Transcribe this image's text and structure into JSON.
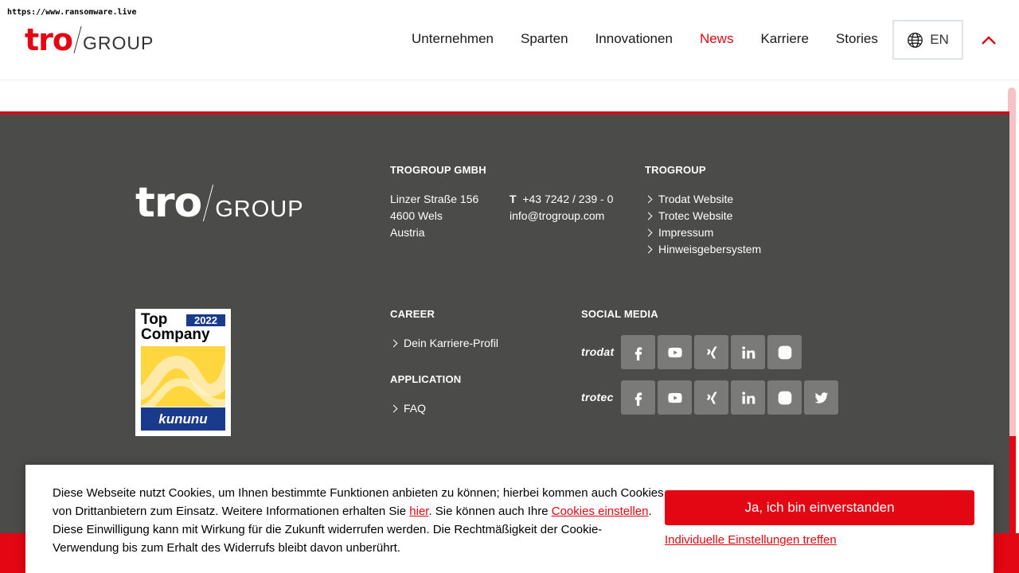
{
  "watermark": "https://www.ransomware.live",
  "header": {
    "logo_tro": "tro",
    "logo_group": "GROUP",
    "nav": [
      {
        "label": "Unternehmen"
      },
      {
        "label": "Sparten"
      },
      {
        "label": "Innovationen"
      },
      {
        "label": "News",
        "active": true
      },
      {
        "label": "Karriere"
      },
      {
        "label": "Stories"
      }
    ],
    "language": "EN"
  },
  "footer": {
    "logo_tro": "tro",
    "logo_group": "GROUP",
    "company": {
      "heading": "TROGROUP GMBH",
      "address": [
        "Linzer Straße 156",
        "4600 Wels",
        "Austria"
      ],
      "phone_prefix": "T",
      "phone": "+43 7242 / 239 - 0",
      "email": "info@trogroup.com"
    },
    "trogroup": {
      "heading": "TROGROUP",
      "links": [
        "Trodat Website",
        "Trotec Website",
        "Impressum",
        "Hinweisgebersystem"
      ]
    },
    "badge": {
      "top": "Top",
      "year": "2022",
      "company": "Company",
      "brand": "kununu"
    },
    "career": {
      "heading": "CAREER",
      "links": [
        "Dein Karriere-Profil"
      ]
    },
    "application": {
      "heading": "APPLICATION",
      "links": [
        "FAQ"
      ]
    },
    "social": {
      "heading": "SOCIAL MEDIA",
      "trodat_label": "trodat",
      "trotec_label": "trotec",
      "trodat_icons": [
        "facebook-icon",
        "youtube-icon",
        "xing-icon",
        "linkedin-icon",
        "instagram-icon"
      ],
      "trotec_icons": [
        "facebook-icon",
        "youtube-icon",
        "xing-icon",
        "linkedin-icon",
        "instagram-icon",
        "twitter-icon"
      ]
    }
  },
  "cookie": {
    "text_1": "Diese Webseite nutzt Cookies, um Ihnen bestimmte Funktionen anbieten zu können; hierbei kommen auch Cookies von Drittanbietern zum Einsatz. Weitere Informationen erhalten Sie ",
    "link_here": "hier",
    "text_2": ". Sie können auch Ihre ",
    "link_settings": "Cookies einstellen",
    "text_3": ". Diese Einwilligung kann mit Wirkung für die Zukunft widerrufen werden. Die Rechtmäßigkeit der Cookie-Verwendung bis zum Erhalt des Widerrufs bleibt davon unberührt.",
    "accept": "Ja, ich bin einverstanden",
    "individual": "Individuelle Einstellungen treffen"
  },
  "colors": {
    "brand_red": "#e30613",
    "footer_bg": "#4b4b49",
    "social_btn": "#7a7a78"
  }
}
